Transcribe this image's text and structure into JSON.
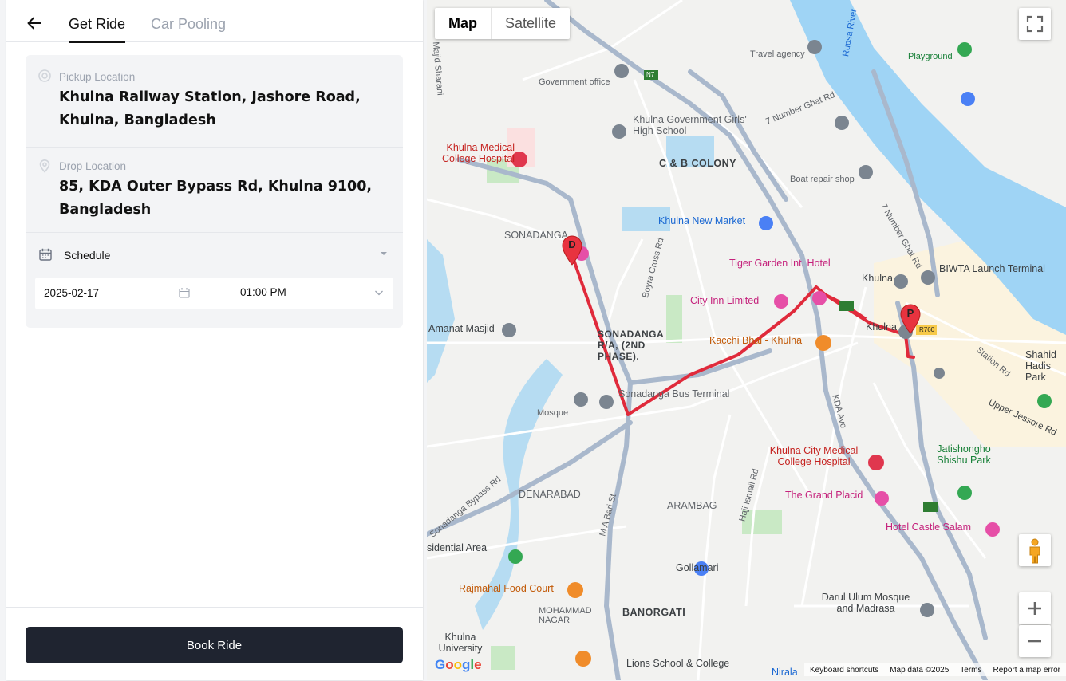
{
  "tabs": {
    "active": "Get Ride",
    "inactive": "Car Pooling"
  },
  "pickup": {
    "label": "Pickup Location",
    "address": "Khulna Railway Station, Jashore Road, Khulna, Bangladesh"
  },
  "drop": {
    "label": "Drop Location",
    "address": "85, KDA Outer Bypass Rd, Khulna 9100, Bangladesh"
  },
  "schedule": {
    "label": "Schedule",
    "date": "2025-02-17",
    "time": "01:00 PM"
  },
  "book_label": "Book Ride",
  "map": {
    "type_map": "Map",
    "type_satellite": "Satellite",
    "attribution": {
      "shortcuts": "Keyboard shortcuts",
      "data": "Map data ©2025",
      "terms": "Terms",
      "report": "Report a map error"
    },
    "google": "Google",
    "markers": {
      "pickup": "P",
      "drop": "D"
    },
    "labels": {
      "c_b_colony": "C & B COLONY",
      "sonadanga": "SONADANGA",
      "sonadanga_ra": "SONADANGA R/A, (2ND PHASE).",
      "denarabad": "DENARABAD",
      "arambag": "ARAMBAG",
      "banorgati": "BANORGATI",
      "mohammad_nagar": "MOHAMMAD NAGAR",
      "khulna_govt_school": "Khulna Government Girls' High School",
      "khulna_medical": "Khulna Medical College Hospital",
      "khulna_new_market": "Khulna New Market",
      "tiger_garden": "Tiger Garden Int. Hotel",
      "city_inn": "City Inn Limited",
      "kacchi_bhai": "Kacchi Bhai - Khulna",
      "sonadanga_bus": "Sonadanga Bus Terminal",
      "khulna_city_medical": "Khulna City Medical College Hospital",
      "grand_placid": "The Grand Placid",
      "hotel_castle": "Hotel Castle Salam",
      "biwta": "BIWTA Launch Terminal",
      "khulna1": "Khulna",
      "khulna2": "Khulna",
      "rupsa": "Rupsa River",
      "n7_ghat": "7 Number Ghat Rd",
      "n7_ghat2": "7 Number Ghat Rd",
      "boyra": "Boyra Cross Rd",
      "kda": "KDA Ave",
      "majid": "Majid Sharani",
      "m_a_bari": "M A Bari St",
      "haji": "Haji Ismail Rd",
      "bypass": "Sonadanga Bypass Rd",
      "station_rd": "Station Rd",
      "upper_jessore": "Upper Jessore Rd",
      "jatishongho": "Jatishongho Shishu Park",
      "gollamari": "Gollamari",
      "rajmahal": "Rajmahal Food Court",
      "amanat": "Amanat Masjid",
      "darul_ulum": "Darul Ulum Mosque and Madrasa",
      "lions": "Lions School & College",
      "nirala": "Nirala",
      "khulna_univ": "Khulna University",
      "residential": "sidential Area",
      "government_office": "Government office",
      "travel_agency": "Travel agency",
      "playground": "Playground",
      "boat_repair": "Boat repair shop",
      "mosque": "Mosque",
      "shahid": "Shahid Hadis Park",
      "n7": "N7",
      "r760": "R760"
    }
  }
}
